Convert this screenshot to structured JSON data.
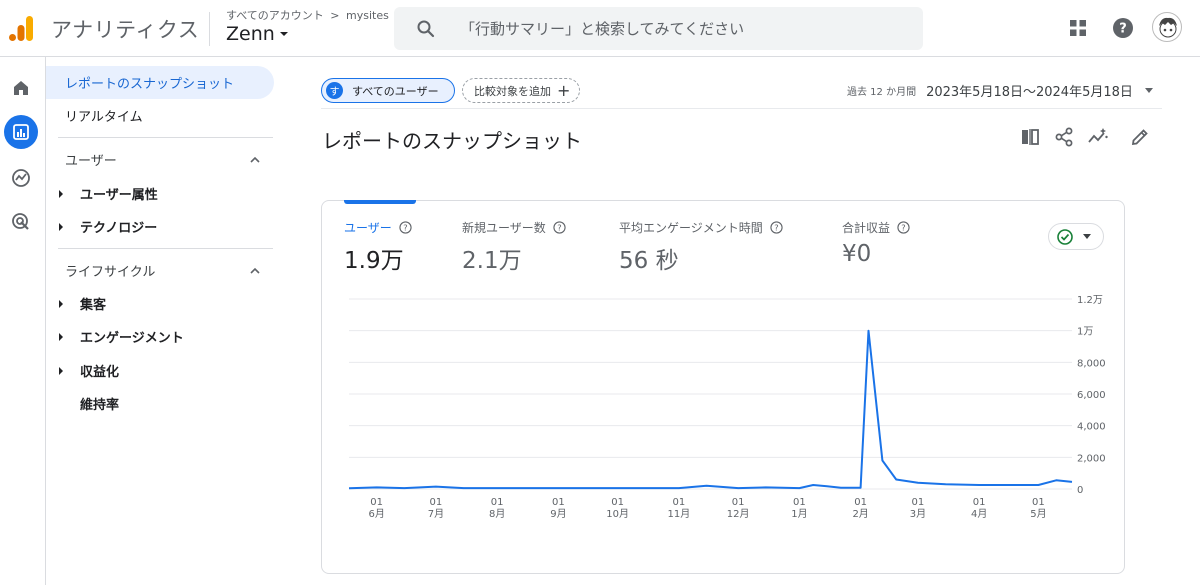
{
  "header": {
    "app_title": "アナリティクス",
    "breadcrumb_account": "すべてのアカウント",
    "breadcrumb_sep": ">",
    "breadcrumb_site": "mysites",
    "property_name": "Zenn",
    "search_placeholder": "「行動サマリー」と検索してみてください"
  },
  "rail": [
    "home-icon",
    "reports-icon",
    "explore-icon",
    "advertising-icon"
  ],
  "nav": {
    "top_items": [
      {
        "label": "レポートのスナップショット",
        "active": true
      },
      {
        "label": "リアルタイム",
        "active": false
      }
    ],
    "sections": [
      {
        "label": "ユーザー",
        "items": [
          "ユーザー属性",
          "テクノロジー"
        ]
      },
      {
        "label": "ライフサイクル",
        "items": [
          "集客",
          "エンゲージメント",
          "収益化"
        ],
        "extra": "維持率"
      }
    ]
  },
  "filters": {
    "segment_badge": "す",
    "segment_label": "すべてのユーザー",
    "compare_label": "比較対象を追加",
    "compare_icon": "+"
  },
  "date_range": {
    "prefix": "過去 12 か月間",
    "value": "2023年5月18日～2024年5月18日"
  },
  "page_title": "レポートのスナップショット",
  "metrics": [
    {
      "label": "ユーザー",
      "value": "1.9万",
      "active": true
    },
    {
      "label": "新規ユーザー数",
      "value": "2.1万",
      "active": false
    },
    {
      "label": "平均エンゲージメント時間",
      "value": "56 秒",
      "active": false
    },
    {
      "label": "合計収益",
      "value": "¥0",
      "active": false
    }
  ],
  "colors": {
    "accent": "#1a73e8",
    "line": "#1a73e8",
    "check": "#188038"
  },
  "chart_data": {
    "type": "line",
    "y_ticks": [
      "0",
      "2,000",
      "4,000",
      "6,000",
      "8,000",
      "1万",
      "1.2万"
    ],
    "ylim": [
      0,
      12000
    ],
    "x_tick_labels": [
      {
        "day": "01",
        "month": "6月"
      },
      {
        "day": "01",
        "month": "7月"
      },
      {
        "day": "01",
        "month": "8月"
      },
      {
        "day": "01",
        "month": "9月"
      },
      {
        "day": "01",
        "month": "10月"
      },
      {
        "day": "01",
        "month": "11月"
      },
      {
        "day": "01",
        "month": "12月"
      },
      {
        "day": "01",
        "month": "1月"
      },
      {
        "day": "01",
        "month": "2月"
      },
      {
        "day": "01",
        "month": "3月"
      },
      {
        "day": "01",
        "month": "4月"
      },
      {
        "day": "01",
        "month": "5月"
      }
    ],
    "series": [
      {
        "x": [
          "2023-05-18",
          "2023-06-01",
          "2023-06-15",
          "2023-07-01",
          "2023-07-15",
          "2023-08-01",
          "2023-08-15",
          "2023-09-01",
          "2023-09-15",
          "2023-10-01",
          "2023-10-15",
          "2023-11-01",
          "2023-11-15",
          "2023-12-01",
          "2023-12-15",
          "2024-01-01",
          "2024-01-08",
          "2024-01-15",
          "2024-01-22",
          "2024-02-01",
          "2024-02-05",
          "2024-02-12",
          "2024-02-19",
          "2024-03-01",
          "2024-03-15",
          "2024-04-01",
          "2024-04-15",
          "2024-05-01",
          "2024-05-10",
          "2024-05-18"
        ],
        "values": [
          50,
          100,
          60,
          150,
          60,
          60,
          60,
          60,
          60,
          60,
          60,
          60,
          200,
          60,
          100,
          60,
          250,
          180,
          80,
          80,
          10000,
          1800,
          600,
          400,
          300,
          250,
          250,
          250,
          550,
          450
        ]
      }
    ]
  }
}
